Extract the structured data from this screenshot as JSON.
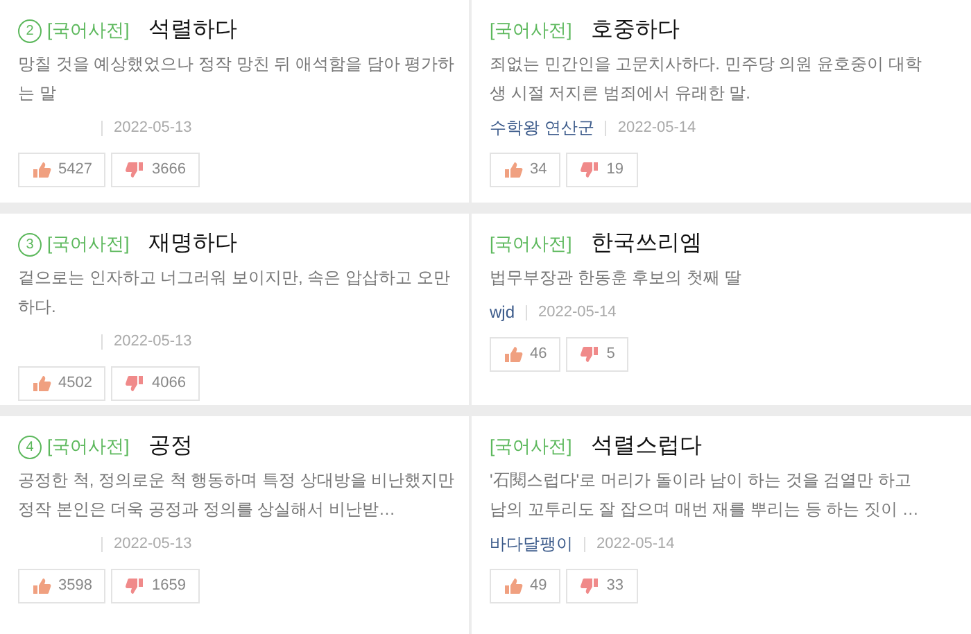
{
  "entries": [
    {
      "rank": "2",
      "category": "[국어사전]",
      "word": "석렬하다",
      "definition": "망칠 것을 예상했었으나 정작 망친 뒤 애석함을 담아 평가하는 말",
      "date": "2022-05-13",
      "likes": "5427",
      "dislikes": "3666"
    },
    {
      "category": "[국어사전]",
      "word": "호중하다",
      "definition": "죄없는 민간인을 고문치사하다. 민주당 의원 윤호중이 대학생 시절 저지른 범죄에서 유래한 말.",
      "author": "수학왕 연산군",
      "date": "2022-05-14",
      "likes": "34",
      "dislikes": "19"
    },
    {
      "rank": "3",
      "category": "[국어사전]",
      "word": "재명하다",
      "definition": "겉으로는 인자하고 너그러워 보이지만, 속은 압삽하고 오만하다.",
      "date": "2022-05-13",
      "likes": "4502",
      "dislikes": "4066"
    },
    {
      "category": "[국어사전]",
      "word": "한국쓰리엠",
      "definition": "법무부장관 한동훈 후보의 첫째 딸",
      "author": "wjd",
      "date": "2022-05-14",
      "likes": "46",
      "dislikes": "5"
    },
    {
      "rank": "4",
      "category": "[국어사전]",
      "word": "공정",
      "definition": "공정한 척, 정의로운 척 행동하며 특정 상대방을 비난했지만 정작 본인은 더욱 공정과 정의를 상실해서 비난받…",
      "date": "2022-05-13",
      "likes": "3598",
      "dislikes": "1659"
    },
    {
      "category": "[국어사전]",
      "word": "석렬스럽다",
      "definition": "'石閱스럽다'로 머리가 돌이라 남이 하는 것을 검열만 하고 남의 꼬투리도 잘 잡으며 매번 재를 뿌리는 등 하는 짓이 …",
      "author": "바다달팽이",
      "date": "2022-05-14",
      "likes": "49",
      "dislikes": "33"
    }
  ]
}
